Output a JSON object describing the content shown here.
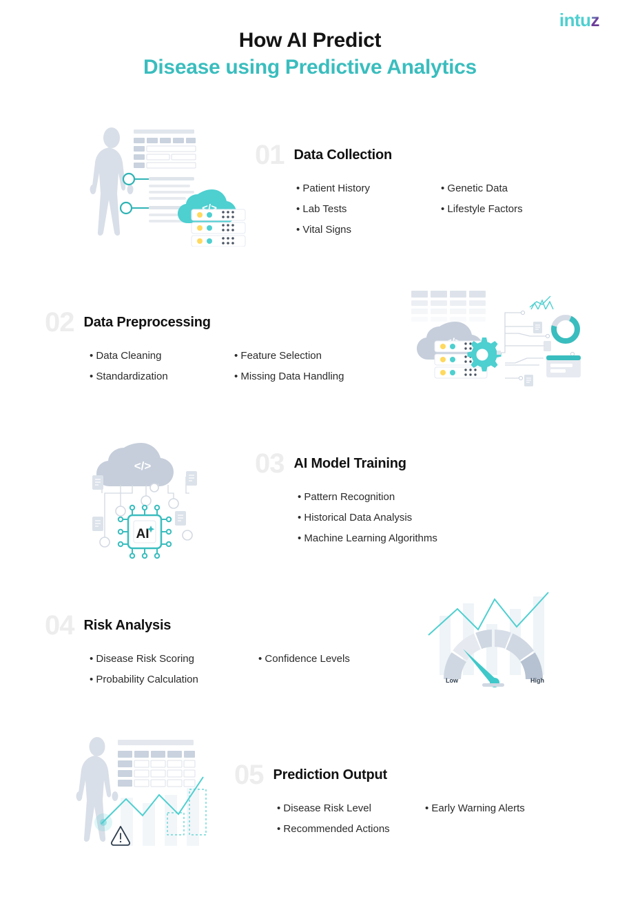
{
  "brand": {
    "logo_text": "Intuz",
    "logo_main": "intu",
    "logo_accent": "z",
    "teal": "#3ABDBE",
    "accent_purple": "#6f3f9e",
    "number_gray": "#EDEDED",
    "body_text": "#2b2b2b"
  },
  "header": {
    "title_line1": "How AI Predict",
    "title_line2": "Disease using Predictive Analytics"
  },
  "steps": [
    {
      "number": "01",
      "title": "Data Collection",
      "bullets_left": [
        "Patient History",
        "Lab Tests",
        "Vital Signs"
      ],
      "bullets_right": [
        "Genetic Data",
        "Lifestyle Factors"
      ],
      "art": "human-body-data-cloud-server",
      "art_side": "left",
      "art_labels": {
        "code_symbol": "</>"
      }
    },
    {
      "number": "02",
      "title": "Data Preprocessing",
      "bullets_left": [
        "Data Cleaning",
        "Standardization"
      ],
      "bullets_right": [
        "Feature Selection",
        "Missing Data Handling"
      ],
      "art": "cloud-server-gear-pipeline",
      "art_side": "right",
      "art_labels": {
        "code_symbol": "</>"
      }
    },
    {
      "number": "03",
      "title": "AI Model Training",
      "bullets_left": [
        "Pattern Recognition",
        "Historical Data Analysis",
        "Machine Learning Algorithms"
      ],
      "bullets_right": [],
      "art": "cloud-network-ai-chip",
      "art_side": "left",
      "art_labels": {
        "code_symbol": "</>",
        "chip_label": "AI"
      }
    },
    {
      "number": "04",
      "title": "Risk Analysis",
      "bullets_left": [
        "Disease Risk Scoring",
        "Probability Calculation"
      ],
      "bullets_right": [
        "Confidence Levels"
      ],
      "art": "risk-gauge-trend-chart",
      "art_side": "right",
      "art_labels": {
        "gauge_low": "Low",
        "gauge_high": "High"
      }
    },
    {
      "number": "05",
      "title": "Prediction Output",
      "bullets_left": [
        "Disease Risk Level",
        "Recommended Actions"
      ],
      "bullets_right": [
        "Early Warning Alerts"
      ],
      "art": "human-body-table-trend-warning",
      "art_side": "left",
      "art_labels": {
        "warning_symbol": "!"
      }
    }
  ]
}
